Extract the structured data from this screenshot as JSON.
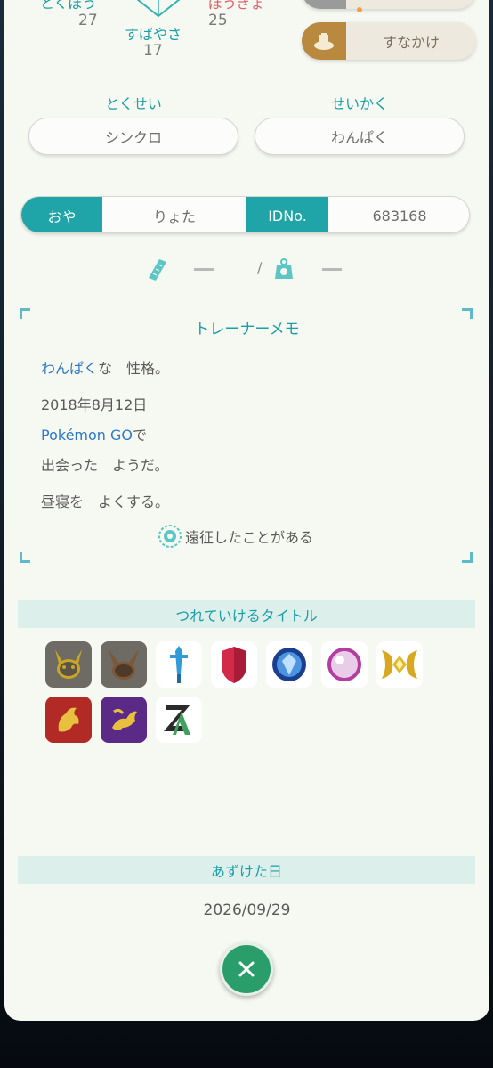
{
  "stats": {
    "attack_label": "とくぼう",
    "attack_value": "27",
    "speed_label": "すばやさ",
    "speed_value": "17",
    "spdef_label": "ぼうぎょ",
    "spdef_value": "25"
  },
  "side_buttons": {
    "top_label": "",
    "sand_label": "すなかけ",
    "sand_icon": "sand-attack-icon"
  },
  "ability": {
    "header": "とくせい",
    "value": "シンクロ"
  },
  "nature": {
    "header": "せいかく",
    "value": "わんぱく"
  },
  "ot": {
    "ot_label": "おや",
    "ot_value": "りょた",
    "id_label": "IDNo.",
    "id_value": "683168"
  },
  "measure": {
    "height_value": "—",
    "separator": "/",
    "weight_value": "—"
  },
  "memo": {
    "title": "トレーナーメモ",
    "nature_highlight": "わんぱく",
    "nature_rest": "な　性格。",
    "date": "2018年8月12日",
    "game_highlight": "Pokémon GO",
    "game_rest": "で",
    "met": "出会った　ようだ。",
    "characteristic": "昼寝を　よくする。",
    "expedition": "遠征したことがある"
  },
  "titles": {
    "header": "つれていけるタイトル",
    "ribbons": [
      "pikachu-silhouette-icon",
      "eevee-silhouette-icon",
      "sword-ribbon-icon",
      "shield-ribbon-icon",
      "sapphire-ribbon-icon",
      "pearl-ribbon-icon",
      "gold-crest-ribbon-icon",
      "red-dragon-ribbon-icon",
      "purple-dragon-ribbon-icon",
      "legends-za-ribbon-icon"
    ]
  },
  "deposit": {
    "header": "あずけた日",
    "date": "2026/09/29"
  },
  "colors": {
    "teal": "#1a9fa6",
    "blue": "#2d78c8",
    "close_green": "#2a9e6a",
    "card_bg": "#f6f8f2"
  }
}
